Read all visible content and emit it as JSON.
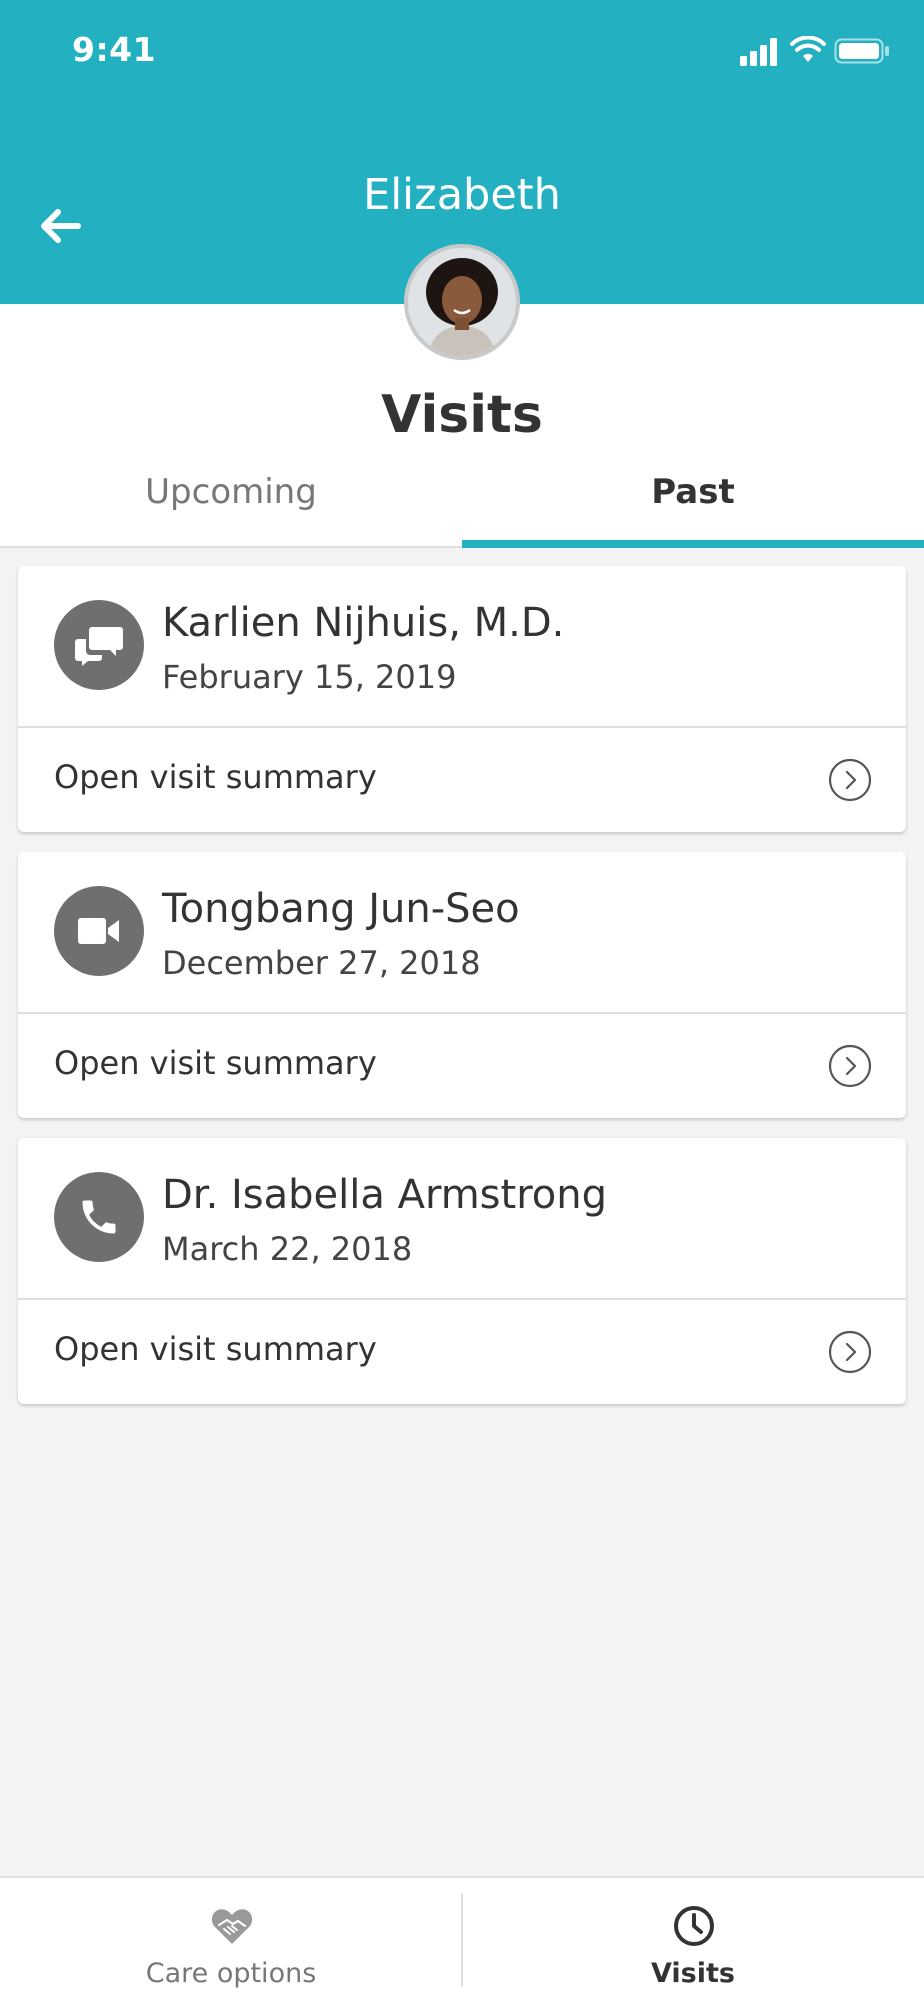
{
  "status_bar": {
    "time": "9:41"
  },
  "header": {
    "name": "Elizabeth",
    "back_icon": "arrow-left-icon",
    "avatar_icon": "profile-photo"
  },
  "page": {
    "title": "Visits"
  },
  "tabs": {
    "upcoming": "Upcoming",
    "past": "Past",
    "active": "past"
  },
  "visits": [
    {
      "provider": "Karlien Nijhuis, M.D.",
      "date": "February 15, 2019",
      "type_icon": "chat-icon",
      "action": "Open visit summary"
    },
    {
      "provider": "Tongbang Jun-Seo",
      "date": "December 27, 2018",
      "type_icon": "video-camera-icon",
      "action": "Open visit summary"
    },
    {
      "provider": "Dr. Isabella Armstrong",
      "date": "March 22, 2018",
      "type_icon": "phone-icon",
      "action": "Open visit summary"
    }
  ],
  "tab_bar": {
    "care_options": {
      "label": "Care options",
      "icon": "handshake-heart-icon"
    },
    "visits": {
      "label": "Visits",
      "icon": "clock-icon",
      "active": true
    }
  },
  "colors": {
    "accent": "#23b1c2",
    "icon_bg": "#6f6f6f",
    "background": "#f3f3f3"
  }
}
